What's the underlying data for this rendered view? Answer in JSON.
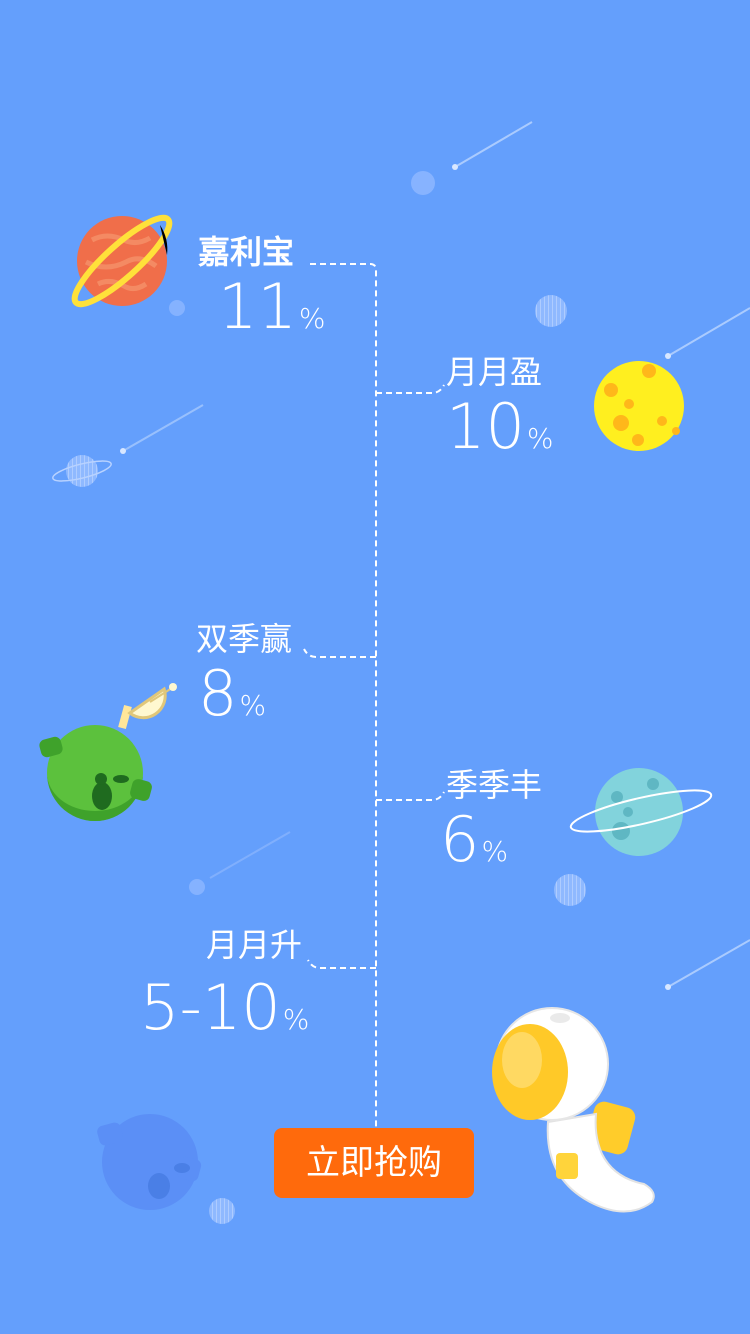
{
  "products": [
    {
      "name": "嘉利宝",
      "rate": "11",
      "unit": "%"
    },
    {
      "name": "月月盈",
      "rate": "10",
      "unit": "%"
    },
    {
      "name": "双季赢",
      "rate": "8",
      "unit": "%"
    },
    {
      "name": "季季丰",
      "rate": "6",
      "unit": "%"
    },
    {
      "name": "月月升",
      "rate": "5-10",
      "unit": "%"
    }
  ],
  "cta": {
    "label": "立即抢购",
    "color": "#ff6a0c"
  },
  "colors": {
    "background": "#649ffc"
  },
  "icons": [
    "orange-ringed-planet-icon",
    "yellow-moon-icon",
    "green-satellite-planet-icon",
    "teal-ringed-planet-icon",
    "astronaut-icon",
    "blue-planet-icon",
    "shooting-star-icon"
  ]
}
